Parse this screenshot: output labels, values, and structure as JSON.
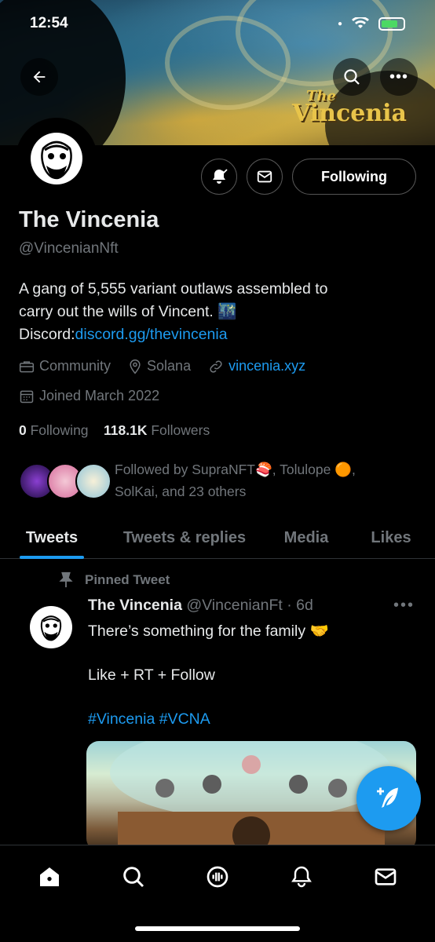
{
  "status_bar": {
    "time": "12:54"
  },
  "banner": {
    "brand_small": "The",
    "brand_large": "Vincenia"
  },
  "profile": {
    "name": "The Vincenia",
    "handle": "@VincenianNft",
    "bio_line1": "A gang of 5,555 variant outlaws assembled to",
    "bio_line2": "carry out the wills of Vincent. 🌃",
    "bio_discord_label": "Discord:",
    "bio_discord_link": "discord.gg/thevincenia",
    "category": "Community",
    "location": "Solana",
    "website": "vincenia.xyz",
    "joined": "Joined March 2022",
    "following_count": "0",
    "following_label": "Following",
    "followers_count": "118.1K",
    "followers_label": "Followers",
    "followed_by": "Followed by SupraNFT🍣, Tolulope 🟠,",
    "followed_by_2": "SolKai, and 23 others",
    "follow_button": "Following"
  },
  "tabs": [
    "Tweets",
    "Tweets & replies",
    "Media",
    "Likes"
  ],
  "tweet": {
    "pinned_label": "Pinned Tweet",
    "author": "The Vincenia",
    "handle_time": "@VincenianFt · 6d",
    "line1": "There’s something for the family 🤝",
    "line2": "Like + RT + Follow",
    "line3": "#Vincenia #VCNA"
  },
  "colors": {
    "accent": "#1d9bf0",
    "muted": "#71767b",
    "text": "#e7e9ea"
  }
}
